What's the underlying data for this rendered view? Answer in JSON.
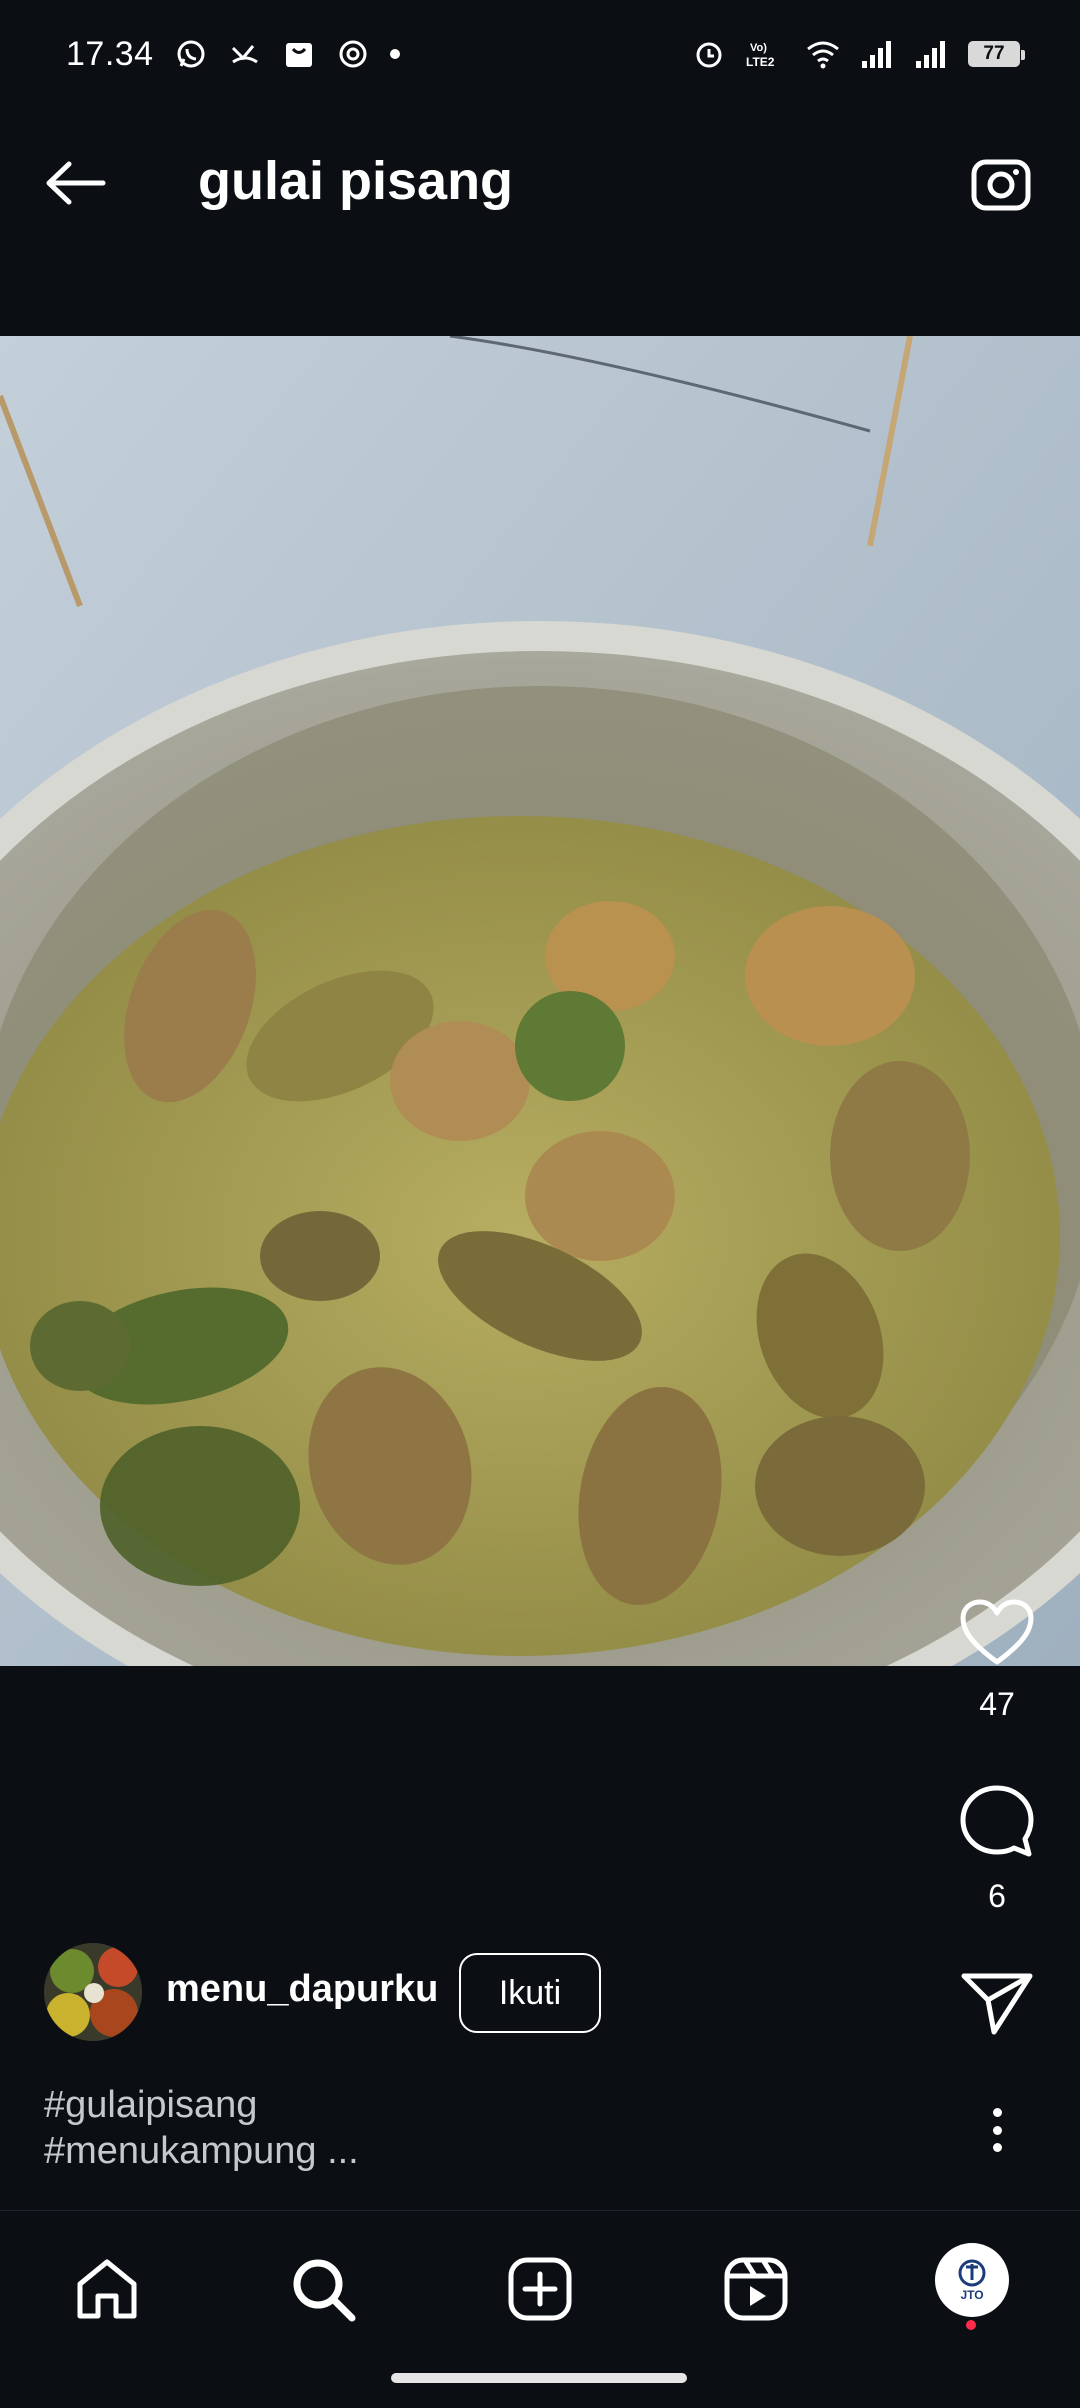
{
  "status_bar": {
    "time": "17.34",
    "battery": "77",
    "network_label": "LTE2"
  },
  "header": {
    "title": "gulai pisang"
  },
  "post": {
    "likes": "47",
    "comments": "6",
    "author": "menu_dapurku",
    "follow_label": "Ikuti",
    "caption_lines": [
      "#gulaipisang",
      "#menukampung ..."
    ]
  },
  "profile": {
    "initials": "JTO"
  },
  "colors": {
    "background": "#0b0f14",
    "text": "#ffffff",
    "caption": "#c6c9cc",
    "notification_dot": "#ff2d4b"
  }
}
